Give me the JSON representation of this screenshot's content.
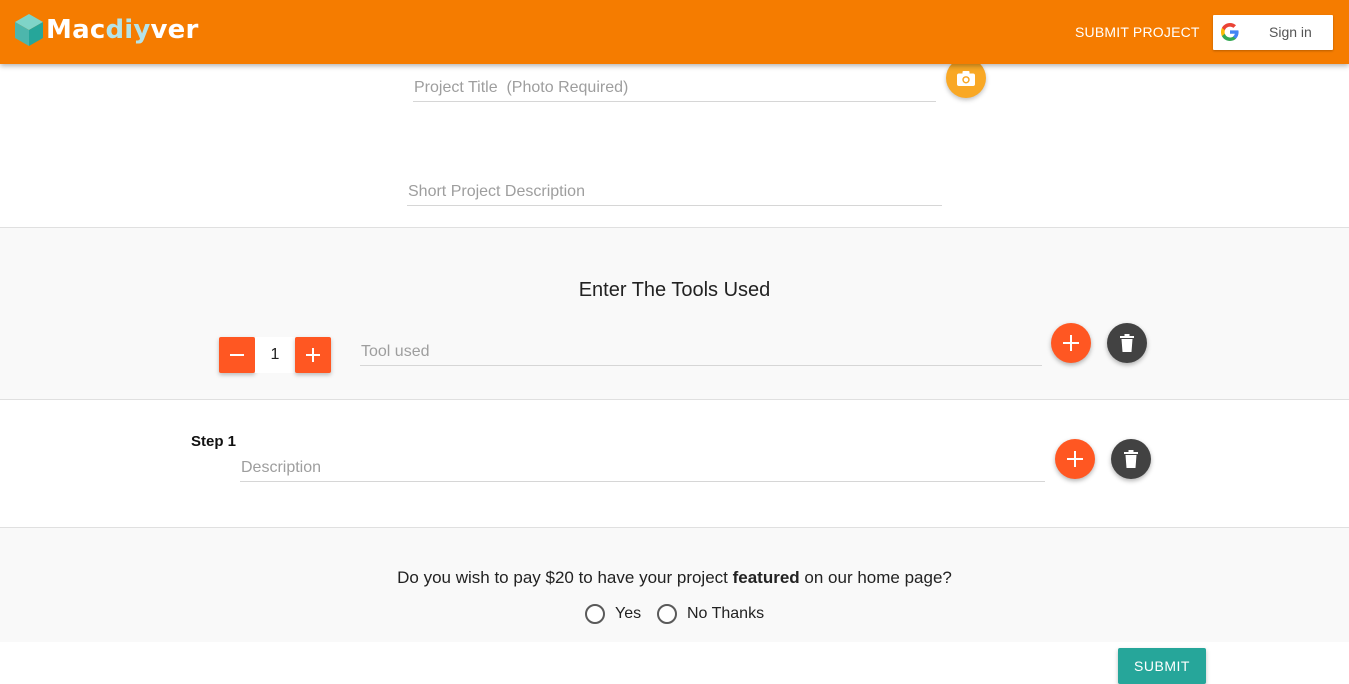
{
  "header": {
    "brand_start": "Mac",
    "brand_mid": "diy",
    "brand_end": "ver",
    "submit_project": "SUBMIT PROJECT",
    "signin_label": "Sign in",
    "accent_color": "#f57c00"
  },
  "form": {
    "title_placeholder": "Project Title  (Photo Required)",
    "description_placeholder": "Short Project Description",
    "photo_button_icon": "camera-icon"
  },
  "tools": {
    "heading": "Enter The Tools Used",
    "quantity": "1",
    "tool_placeholder": "Tool used",
    "decrement_icon": "minus-icon",
    "increment_icon": "plus-icon",
    "add_icon": "plus-icon",
    "delete_icon": "trash-icon"
  },
  "steps": {
    "step_label": "Step 1",
    "description_placeholder": "Description"
  },
  "featured": {
    "question_pre": "Do you wish to pay $20 to have your project ",
    "question_bold": "featured",
    "question_post": " on our home page?",
    "option_yes": "Yes",
    "option_no": "No Thanks"
  },
  "submit_label": "SUBMIT"
}
